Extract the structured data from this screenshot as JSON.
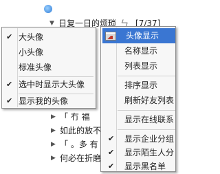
{
  "buddy_list": {
    "top_row": {
      "name": "日复一日的烦琐",
      "mood": "ㄣ",
      "count": "[7/37]"
    },
    "rows": [
      {
        "text": "「 冇 福"
      },
      {
        "text": "如此的放不下"
      },
      {
        "text": "「 。多 有"
      },
      {
        "text": "何必在折磨自"
      }
    ]
  },
  "menu_left": {
    "items": [
      {
        "label": "大头像",
        "checked": true
      },
      {
        "label": "小头像",
        "checked": false
      },
      {
        "label": "标准头像",
        "checked": false
      },
      {
        "label": "选中时显示大头像",
        "checked": true
      },
      {
        "label": "显示我的头像",
        "checked": true
      }
    ]
  },
  "menu_right": {
    "items": [
      {
        "label": "头像显示",
        "highlighted": true,
        "icon": "picture-icon"
      },
      {
        "label": "名称显示"
      },
      {
        "label": "列表显示"
      },
      {
        "label": "排序显示"
      },
      {
        "label": "刷新好友列表"
      },
      {
        "label": "显示在线联系"
      },
      {
        "label": "显示企业分组",
        "checked": true
      },
      {
        "label": "显示陌生人分",
        "checked": true
      },
      {
        "label": "显示黑名单",
        "checked": true
      }
    ]
  },
  "colors": {
    "highlight": "#3a76d2",
    "menu_bg": "#f7f7f7"
  }
}
